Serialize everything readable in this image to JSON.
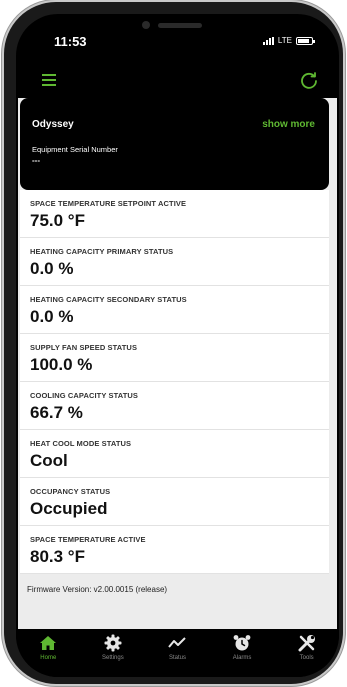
{
  "status_bar": {
    "time": "11:53",
    "network": "LTE"
  },
  "equipment": {
    "name": "Odyssey",
    "show_more_label": "show more",
    "serial_label": "Equipment Serial Number",
    "serial_value": "---"
  },
  "fields": [
    {
      "label": "SPACE TEMPERATURE SETPOINT ACTIVE",
      "value": "75.0 °F"
    },
    {
      "label": "HEATING CAPACITY PRIMARY STATUS",
      "value": "0.0 %"
    },
    {
      "label": "HEATING CAPACITY SECONDARY STATUS",
      "value": "0.0 %"
    },
    {
      "label": "SUPPLY FAN SPEED STATUS",
      "value": "100.0 %"
    },
    {
      "label": "COOLING CAPACITY STATUS",
      "value": "66.7 %"
    },
    {
      "label": "HEAT COOL MODE STATUS",
      "value": "Cool"
    },
    {
      "label": "OCCUPANCY STATUS",
      "value": "Occupied"
    },
    {
      "label": "SPACE TEMPERATURE ACTIVE",
      "value": "80.3 °F"
    }
  ],
  "firmware": "Firmware Version: v2.00.0015 (release)",
  "tabs": [
    {
      "label": "Home",
      "icon": "home-icon",
      "active": true
    },
    {
      "label": "Settings",
      "icon": "gear-icon",
      "active": false
    },
    {
      "label": "Status",
      "icon": "trend-icon",
      "active": false
    },
    {
      "label": "Alarms",
      "icon": "alarm-clock-icon",
      "active": false
    },
    {
      "label": "Tools",
      "icon": "tools-icon",
      "active": false
    }
  ],
  "colors": {
    "accent": "#5fb832",
    "inactive": "#8a8a8a",
    "background": "#ececec"
  }
}
